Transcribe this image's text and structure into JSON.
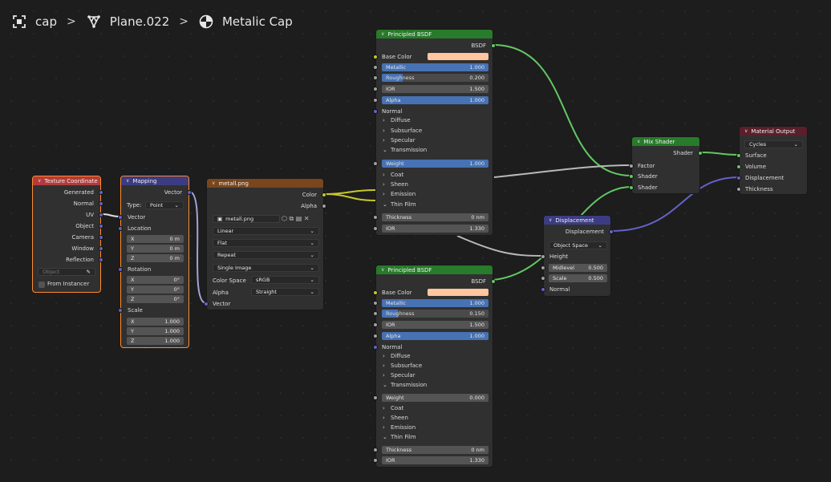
{
  "breadcrumb": {
    "object": "cap",
    "mesh": "Plane.022",
    "material": "Metalic Cap"
  },
  "colors": {
    "input_header": "#b33b3b",
    "vector_header": "#3c3c83",
    "texture_header": "#79461d",
    "shader_header": "#277b2a",
    "output_header": "#5a1f2a",
    "selected_outline": "#ff8c2f"
  },
  "tex_coord": {
    "title": "Texture Coordinate",
    "outputs": [
      "Generated",
      "Normal",
      "UV",
      "Object",
      "Camera",
      "Window",
      "Reflection"
    ],
    "object_placeholder": "Object",
    "from_instancer": "From Instancer"
  },
  "mapping": {
    "title": "Mapping",
    "output": "Vector",
    "type_label": "Type:",
    "type_value": "Point",
    "vector_in": "Vector",
    "location_label": "Location",
    "location": [
      {
        "axis": "X",
        "value": "0 m"
      },
      {
        "axis": "Y",
        "value": "0 m"
      },
      {
        "axis": "Z",
        "value": "0 m"
      }
    ],
    "rotation_label": "Rotation",
    "rotation": [
      {
        "axis": "X",
        "value": "0°"
      },
      {
        "axis": "Y",
        "value": "0°"
      },
      {
        "axis": "Z",
        "value": "0°"
      }
    ],
    "scale_label": "Scale",
    "scale": [
      {
        "axis": "X",
        "value": "1.000"
      },
      {
        "axis": "Y",
        "value": "1.000"
      },
      {
        "axis": "Z",
        "value": "1.000"
      }
    ]
  },
  "image": {
    "title": "metall.png",
    "out_color": "Color",
    "out_alpha": "Alpha",
    "file": "metall.png",
    "interp": "Linear",
    "proj": "Flat",
    "ext": "Repeat",
    "source": "Single Image",
    "cs_label": "Color Space",
    "cs_value": "sRGB",
    "alpha_label": "Alpha",
    "alpha_value": "Straight",
    "vector_in": "Vector"
  },
  "bsdf1": {
    "title": "Principled BSDF",
    "output": "BSDF",
    "base_color": "Base Color",
    "metallic": {
      "label": "Metallic",
      "value": "1.000"
    },
    "roughness": {
      "label": "Roughness",
      "value": "0.200"
    },
    "ior": {
      "label": "IOR",
      "value": "1.500"
    },
    "alpha": {
      "label": "Alpha",
      "value": "1.000"
    },
    "normal": "Normal",
    "panels": [
      "Diffuse",
      "Subsurface",
      "Specular",
      "Transmission"
    ],
    "weight": {
      "label": "Weight",
      "value": "1.000"
    },
    "panels2": [
      "Coat",
      "Sheen",
      "Emission",
      "Thin Film"
    ],
    "thickness": {
      "label": "Thickness",
      "value": "0 nm"
    },
    "ior2": {
      "label": "IOR",
      "value": "1.330"
    }
  },
  "bsdf2": {
    "title": "Principled BSDF",
    "output": "BSDF",
    "base_color": "Base Color",
    "metallic": {
      "label": "Metallic",
      "value": "1.000"
    },
    "roughness": {
      "label": "Roughness",
      "value": "0.150"
    },
    "ior": {
      "label": "IOR",
      "value": "1.500"
    },
    "alpha": {
      "label": "Alpha",
      "value": "1.000"
    },
    "normal": "Normal",
    "panels": [
      "Diffuse",
      "Subsurface",
      "Specular",
      "Transmission"
    ],
    "weight": {
      "label": "Weight",
      "value": "0.000"
    },
    "panels2": [
      "Coat",
      "Sheen",
      "Emission",
      "Thin Film"
    ],
    "thickness": {
      "label": "Thickness",
      "value": "0 nm"
    },
    "ior2": {
      "label": "IOR",
      "value": "1.330"
    }
  },
  "mix": {
    "title": "Mix Shader",
    "output": "Shader",
    "factor": "Factor",
    "shader1": "Shader",
    "shader2": "Shader"
  },
  "displacement": {
    "title": "Displacement",
    "output": "Displacement",
    "space": "Object Space",
    "height": "Height",
    "midlevel": {
      "label": "Midlevel",
      "value": "0.500"
    },
    "scale": {
      "label": "Scale",
      "value": "0.500"
    },
    "normal": "Normal"
  },
  "output": {
    "title": "Material Output",
    "target": "Cycles",
    "surface": "Surface",
    "volume": "Volume",
    "displacement": "Displacement",
    "thickness": "Thickness"
  }
}
